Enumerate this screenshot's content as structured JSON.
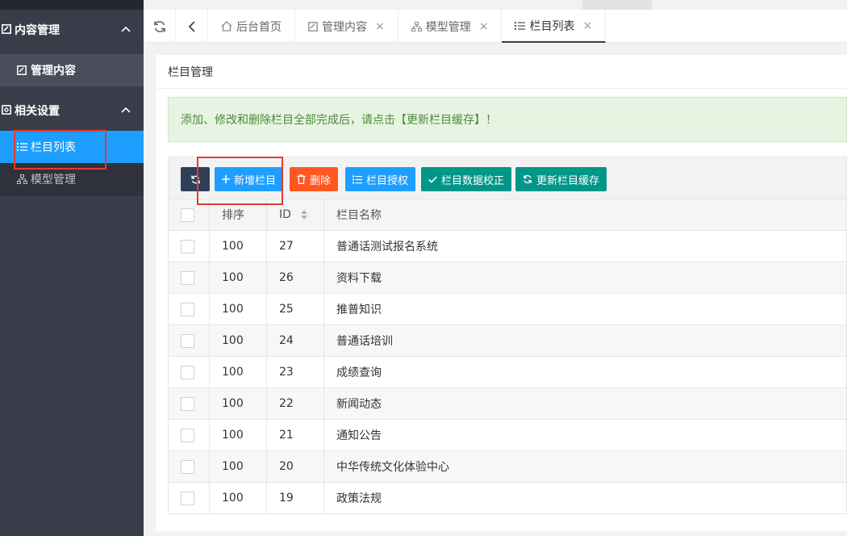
{
  "sidebar": {
    "group_content": "内容管理",
    "item_manage_content": "管理内容",
    "group_settings": "相关设置",
    "item_column_list": "栏目列表",
    "item_model_manage": "模型管理"
  },
  "tabs": [
    {
      "label": "后台首页"
    },
    {
      "label": "管理内容",
      "close": "×"
    },
    {
      "label": "模型管理",
      "close": "×"
    },
    {
      "label": "栏目列表",
      "close": "×"
    }
  ],
  "panel": {
    "title": "栏目管理",
    "notice": "添加、修改和删除栏目全部完成后，请点击【更新栏目缓存】！"
  },
  "toolbar": {
    "add": "新增栏目",
    "delete": "删除",
    "authorize": "栏目授权",
    "verify": "栏目数据校正",
    "update_cache": "更新栏目缓存"
  },
  "colors": {
    "sidebar_bg": "#393d49",
    "active_blue": "#1e9fff",
    "danger": "#ff5722",
    "success": "#009688",
    "dark": "#2f4056"
  },
  "table": {
    "headers": {
      "sort": "排序",
      "id": "ID",
      "name": "栏目名称"
    },
    "rows": [
      {
        "sort": "100",
        "id": "27",
        "name": "普通话测试报名系统"
      },
      {
        "sort": "100",
        "id": "26",
        "name": "资料下载"
      },
      {
        "sort": "100",
        "id": "25",
        "name": "推普知识"
      },
      {
        "sort": "100",
        "id": "24",
        "name": "普通话培训"
      },
      {
        "sort": "100",
        "id": "23",
        "name": "成绩查询"
      },
      {
        "sort": "100",
        "id": "22",
        "name": "新闻动态"
      },
      {
        "sort": "100",
        "id": "21",
        "name": "通知公告"
      },
      {
        "sort": "100",
        "id": "20",
        "name": "中华传统文化体验中心"
      },
      {
        "sort": "100",
        "id": "19",
        "name": "政策法规"
      }
    ]
  }
}
